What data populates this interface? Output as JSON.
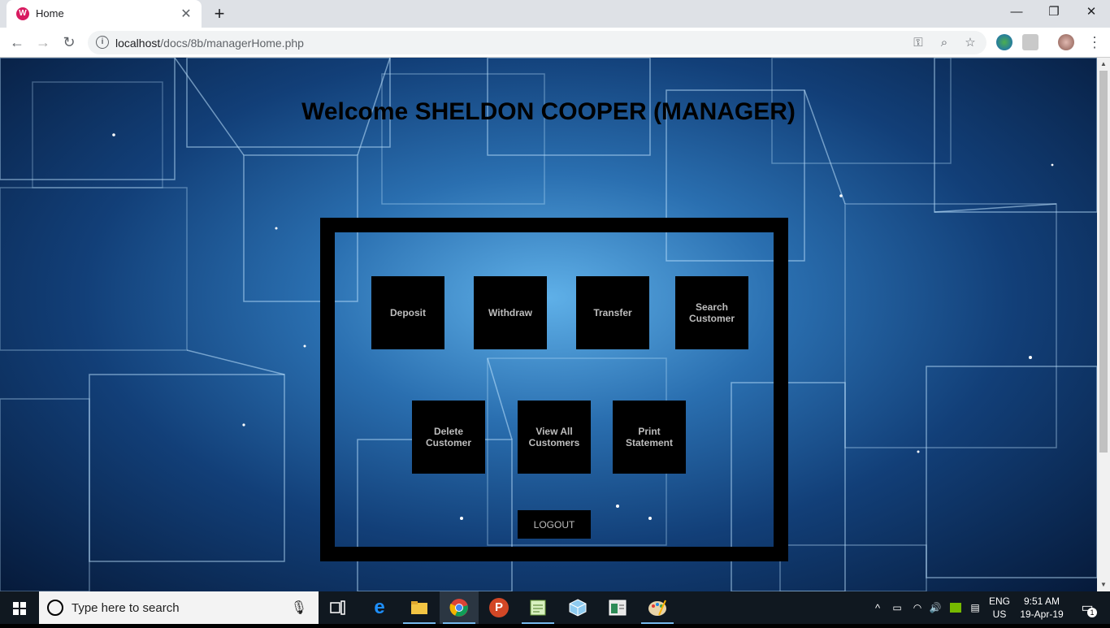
{
  "browser": {
    "tab_title": "Home",
    "tab_favicon_letter": "W",
    "url_host": "localhost",
    "url_path": "/docs/8b/managerHome.php"
  },
  "page": {
    "welcome": "Welcome SHELDON COOPER (MANAGER)",
    "buttons": {
      "deposit": "Deposit",
      "withdraw": "Withdraw",
      "transfer": "Transfer",
      "search_customer": "Search\nCustomer",
      "delete_customer": "Delete\nCustomer",
      "view_all_customers": "View All\nCustomers",
      "print_statement": "Print\nStatement",
      "logout": "LOGOUT"
    }
  },
  "taskbar": {
    "search_placeholder": "Type here to search",
    "lang_top": "ENG",
    "lang_bottom": "US",
    "time": "9:51 AM",
    "date": "19-Apr-19",
    "notification_count": "1"
  }
}
